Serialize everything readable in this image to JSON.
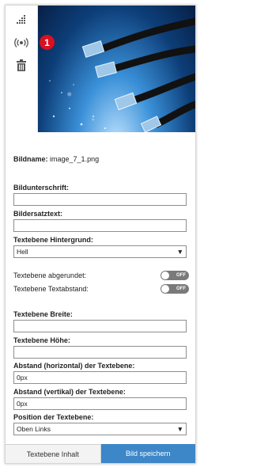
{
  "toolbar": {
    "badge": "1",
    "icons": [
      "grid-dots-icon",
      "broadcast-icon",
      "trash-icon"
    ]
  },
  "filename": {
    "label": "Bildname:",
    "value": "image_7_1.png"
  },
  "caption": {
    "label": "Bildunterschrift:",
    "value": ""
  },
  "alttext": {
    "label": "Bildersatztext:",
    "value": ""
  },
  "background": {
    "label": "Textebene Hintergrund:",
    "value": "Hell"
  },
  "rounded": {
    "label": "Textebene abgerundet:",
    "state": "OFF"
  },
  "padding": {
    "label": "Textebene Textabstand:",
    "state": "OFF"
  },
  "width": {
    "label": "Textebene Breite:",
    "value": ""
  },
  "height": {
    "label": "Textebene Höhe:",
    "value": ""
  },
  "hoffset": {
    "label": "Abstand (horizontal) der Textebene:",
    "value": "0px"
  },
  "voffset": {
    "label": "Abstand (vertikal) der Textebene:",
    "value": "0px"
  },
  "position": {
    "label": "Position der Textebene:",
    "value": "Oben Links"
  },
  "footer": {
    "left": "Textebene Inhalt",
    "right": "Bild speichern"
  },
  "colors": {
    "accent": "#3d86c8",
    "badge": "#d9101f",
    "toggle": "#7a7a7a"
  }
}
